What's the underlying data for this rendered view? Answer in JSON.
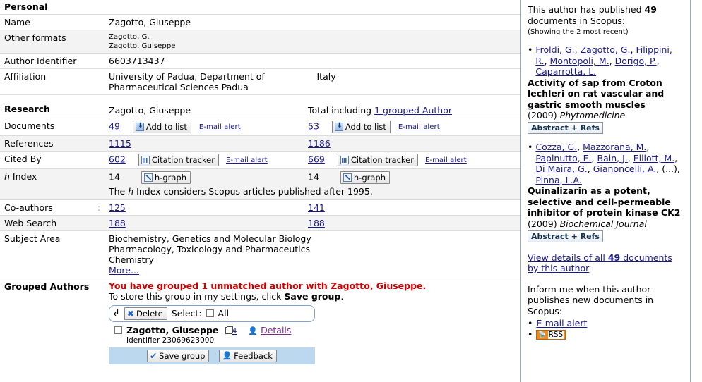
{
  "personal": {
    "heading": "Personal",
    "rows": [
      {
        "label": "Name",
        "value": "Zagotto, Giuseppe"
      },
      {
        "label": "Other formats",
        "value_line1": "Zagotto, G.",
        "value_line2": "Zagotto, Guiseppe"
      },
      {
        "label": "Author Identifier",
        "value": "6603713437"
      },
      {
        "label": "Affiliation",
        "value": "University of Padua, Department of Pharmaceutical Sciences Padua",
        "country": "Italy"
      }
    ]
  },
  "research": {
    "heading": "Research",
    "col1_header": "Zagotto, Giuseppe",
    "col2_header_prefix": "Total including ",
    "col2_header_link": "1 grouped Author",
    "documents": {
      "label": "Documents",
      "own_count": "49",
      "total_count": "53",
      "add_to_list": "Add to list",
      "email_alert": "E-mail alert"
    },
    "references": {
      "label": "References",
      "own_count": "1115",
      "total_count": "1186"
    },
    "cited_by": {
      "label": "Cited By",
      "own_count": "602",
      "total_count": "669",
      "citation_tracker": "Citation tracker",
      "email_alert": "E-mail alert"
    },
    "h_index": {
      "label": "h Index",
      "label_italic": "h",
      "label_rest": " Index",
      "own_value": "14",
      "total_value": "14",
      "hgraph": "h-graph",
      "note_pre": "The ",
      "note_italic": "h",
      "note_post": " Index considers Scopus articles published after 1995."
    },
    "co_authors": {
      "label": "Co-authors",
      "own_count": "125",
      "total_count": "141"
    },
    "web_search": {
      "label": "Web Search",
      "own_count": "188",
      "total_count": "188"
    },
    "subject_area": {
      "label": "Subject Area",
      "items": [
        "Biochemistry, Genetics and Molecular Biology",
        "Pharmacology, Toxicology and Pharmaceutics",
        "Chemistry"
      ],
      "more": "More..."
    }
  },
  "grouped_authors": {
    "label": "Grouped Authors",
    "warning": "You have grouped 1 unmatched author with Zagotto, Giuseppe.",
    "instruction_pre": "To store this group in my settings, click ",
    "instruction_bold": "Save group",
    "instruction_post": ".",
    "delete_button": "Delete",
    "select_label": "Select:",
    "select_all": "All",
    "author": {
      "name": "Zagotto, Giuseppe",
      "identifier": "Identifier 23069623000",
      "doc_count": "4",
      "details": "Details"
    },
    "save_group": "Save group",
    "feedback": "Feedback"
  },
  "sidebar": {
    "published_pre": "This author has published ",
    "published_count": "49",
    "published_post": " documents in Scopus:",
    "showing": "(Showing the 2 most recent)",
    "documents": [
      {
        "authors": [
          "Froldi, G.",
          "Zagotto, G.",
          "Filippini, R.",
          "Montopoli, M.",
          "Dorigo, P.",
          "Caparrotta, L."
        ],
        "authors_trailing": "",
        "title": "Activity of sap from Croton lechleri on rat vascular and gastric smooth muscles",
        "year": "(2009)",
        "source": "Phytomedicine",
        "abstract_button": "Abstract + Refs"
      },
      {
        "authors": [
          "Cozza, G.",
          "Mazzorana, M.",
          "Papinutto, E.",
          "Bain, J.",
          "Elliott, M.",
          "Di Maira, G.",
          "Gianoncelli, A."
        ],
        "authors_trailing": "(...), ",
        "authors_last": "Pinna, L.A.",
        "title": "Quinalizarin as a potent, selective and cell-permeable inhibitor of protein kinase CK2",
        "year": "(2009)",
        "source": "Biochemical Journal",
        "abstract_button": "Abstract + Refs"
      }
    ],
    "view_all_pre": "View details of all ",
    "view_all_count": "49",
    "view_all_post": " documents by this author",
    "inform_text": "Inform me when this author publishes new documents in Scopus:",
    "email_alert": "E-mail alert",
    "rss": "RSS"
  },
  "colors": {
    "link": "#1a1a8c",
    "warning": "#cc0000",
    "visited_link": "#7b2a8e",
    "row_shade": "#f3f3f3",
    "panel_accent": "#bcd8ef",
    "rss_orange": "#f08a1c"
  }
}
